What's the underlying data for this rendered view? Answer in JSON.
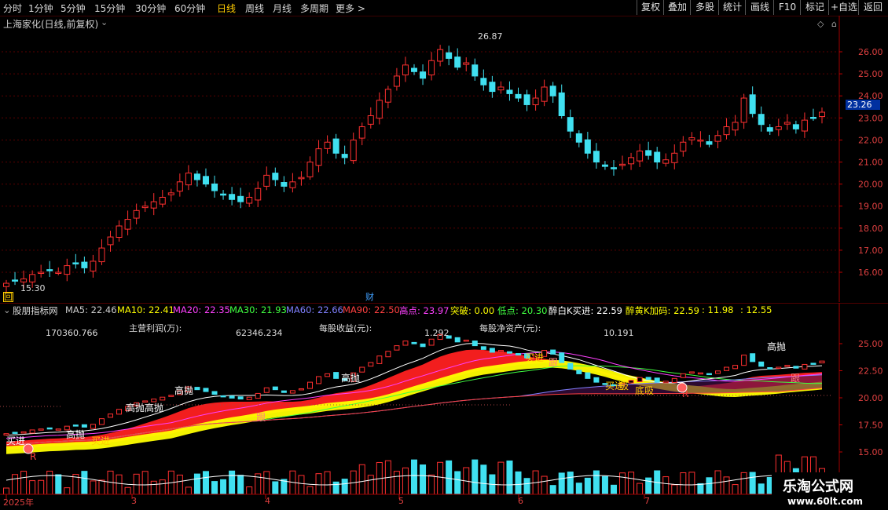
{
  "toolbar": {
    "periods": [
      "分时",
      "1分钟",
      "5分钟",
      "15分钟",
      "30分钟",
      "60分钟",
      "日线",
      "周线",
      "月线",
      "多周期",
      "更多 >"
    ],
    "active_period": "日线",
    "buttons": [
      "复权",
      "叠加",
      "多股",
      "统计",
      "画线",
      "F10",
      "标记",
      "+自选",
      "返回"
    ]
  },
  "main": {
    "title": "上海家化(日线,前复权)",
    "high_label": "26.87",
    "low_label": "15.30",
    "current_price": "23.26",
    "fin_marker": "财",
    "corner_marker": "回",
    "y_ticks": [
      "26.00",
      "25.00",
      "24.00",
      "23.00",
      "22.00",
      "21.00",
      "20.00",
      "19.00",
      "18.00",
      "17.00",
      "16.00"
    ]
  },
  "indicator": {
    "name": "股朋指标网",
    "items": [
      {
        "label": "MA5: 22.46",
        "color": "#ffffff"
      },
      {
        "label": "MA10: 22.41",
        "color": "#ffff00"
      },
      {
        "label": "MA20: 22.35",
        "color": "#ff40ff"
      },
      {
        "label": "MA30: 21.93",
        "color": "#40ff40"
      },
      {
        "label": "MA60: 22.66",
        "color": "#8080ff"
      },
      {
        "label": "MA90: 22.50",
        "color": "#ff4040"
      },
      {
        "label": "高点: 23.97",
        "color": "#ff40ff"
      },
      {
        "label": "突破: 0.00",
        "color": "#ffff00"
      },
      {
        "label": "低点: 20.30",
        "color": "#40ff40"
      },
      {
        "label": "醉白K买进: 22.59",
        "color": "#ffffff"
      },
      {
        "label": "醉黄K加码: 22.59",
        "color": "#ffff00"
      },
      {
        "label": ": 11.98",
        "color": "#ffff00"
      },
      {
        "label": ": 12.55",
        "color": "#ffff00"
      }
    ],
    "fin_texts": {
      "v1": "170360.766",
      "l2": "主营利润(万):",
      "v2": "62346.234",
      "l3": "每股收益(元):",
      "v3": "1.292",
      "l4": "每股净资产(元):",
      "v4": "10.191"
    },
    "y_ticks": [
      "25.00",
      "22.50",
      "20.00",
      "17.50",
      "15.00"
    ],
    "signals": [
      "高抛",
      "高抛",
      "高抛高抛",
      "高抛",
      "高抛",
      "买进",
      "买进",
      "买进",
      "跟",
      "跟",
      "跟",
      "吸",
      "底吸",
      "买进",
      "R",
      "R"
    ]
  },
  "date_axis": {
    "labels": [
      "2025年",
      "3",
      "4",
      "5",
      "6",
      "7"
    ]
  },
  "watermark": {
    "title": "乐淘公式网",
    "url": "www.60lt.com"
  },
  "chart_data": {
    "type": "candlestick",
    "title": "上海家化(日线,前复权)",
    "ylim": [
      15.3,
      26.87
    ],
    "high": 26.87,
    "low": 15.3,
    "last": 23.26,
    "x_labels": [
      "2025年",
      "3",
      "4",
      "5",
      "6",
      "7"
    ],
    "close_series": [
      15.5,
      15.6,
      15.7,
      15.9,
      16.0,
      16.1,
      16.0,
      16.3,
      16.4,
      16.2,
      16.5,
      17.1,
      17.6,
      18.1,
      18.4,
      18.8,
      19.0,
      19.2,
      19.4,
      19.6,
      20.1,
      20.5,
      20.2,
      20.0,
      19.7,
      19.5,
      19.3,
      19.2,
      19.4,
      19.8,
      20.4,
      20.2,
      19.9,
      20.1,
      20.3,
      21.0,
      21.6,
      21.9,
      21.4,
      21.2,
      22.0,
      22.6,
      23.1,
      23.8,
      24.3,
      24.9,
      25.4,
      25.1,
      24.8,
      25.6,
      26.1,
      25.7,
      25.3,
      25.5,
      24.9,
      24.5,
      24.2,
      24.4,
      24.1,
      23.9,
      23.6,
      23.9,
      24.4,
      24.0,
      23.1,
      22.4,
      21.9,
      21.4,
      21.0,
      20.8,
      20.7,
      20.9,
      21.2,
      21.5,
      21.3,
      21.0,
      21.1,
      21.4,
      21.9,
      22.1,
      22.0,
      21.8,
      22.2,
      22.6,
      22.8,
      23.9,
      23.2,
      22.7,
      22.4,
      22.6,
      22.8,
      22.5,
      22.9,
      23.0,
      23.26
    ]
  }
}
